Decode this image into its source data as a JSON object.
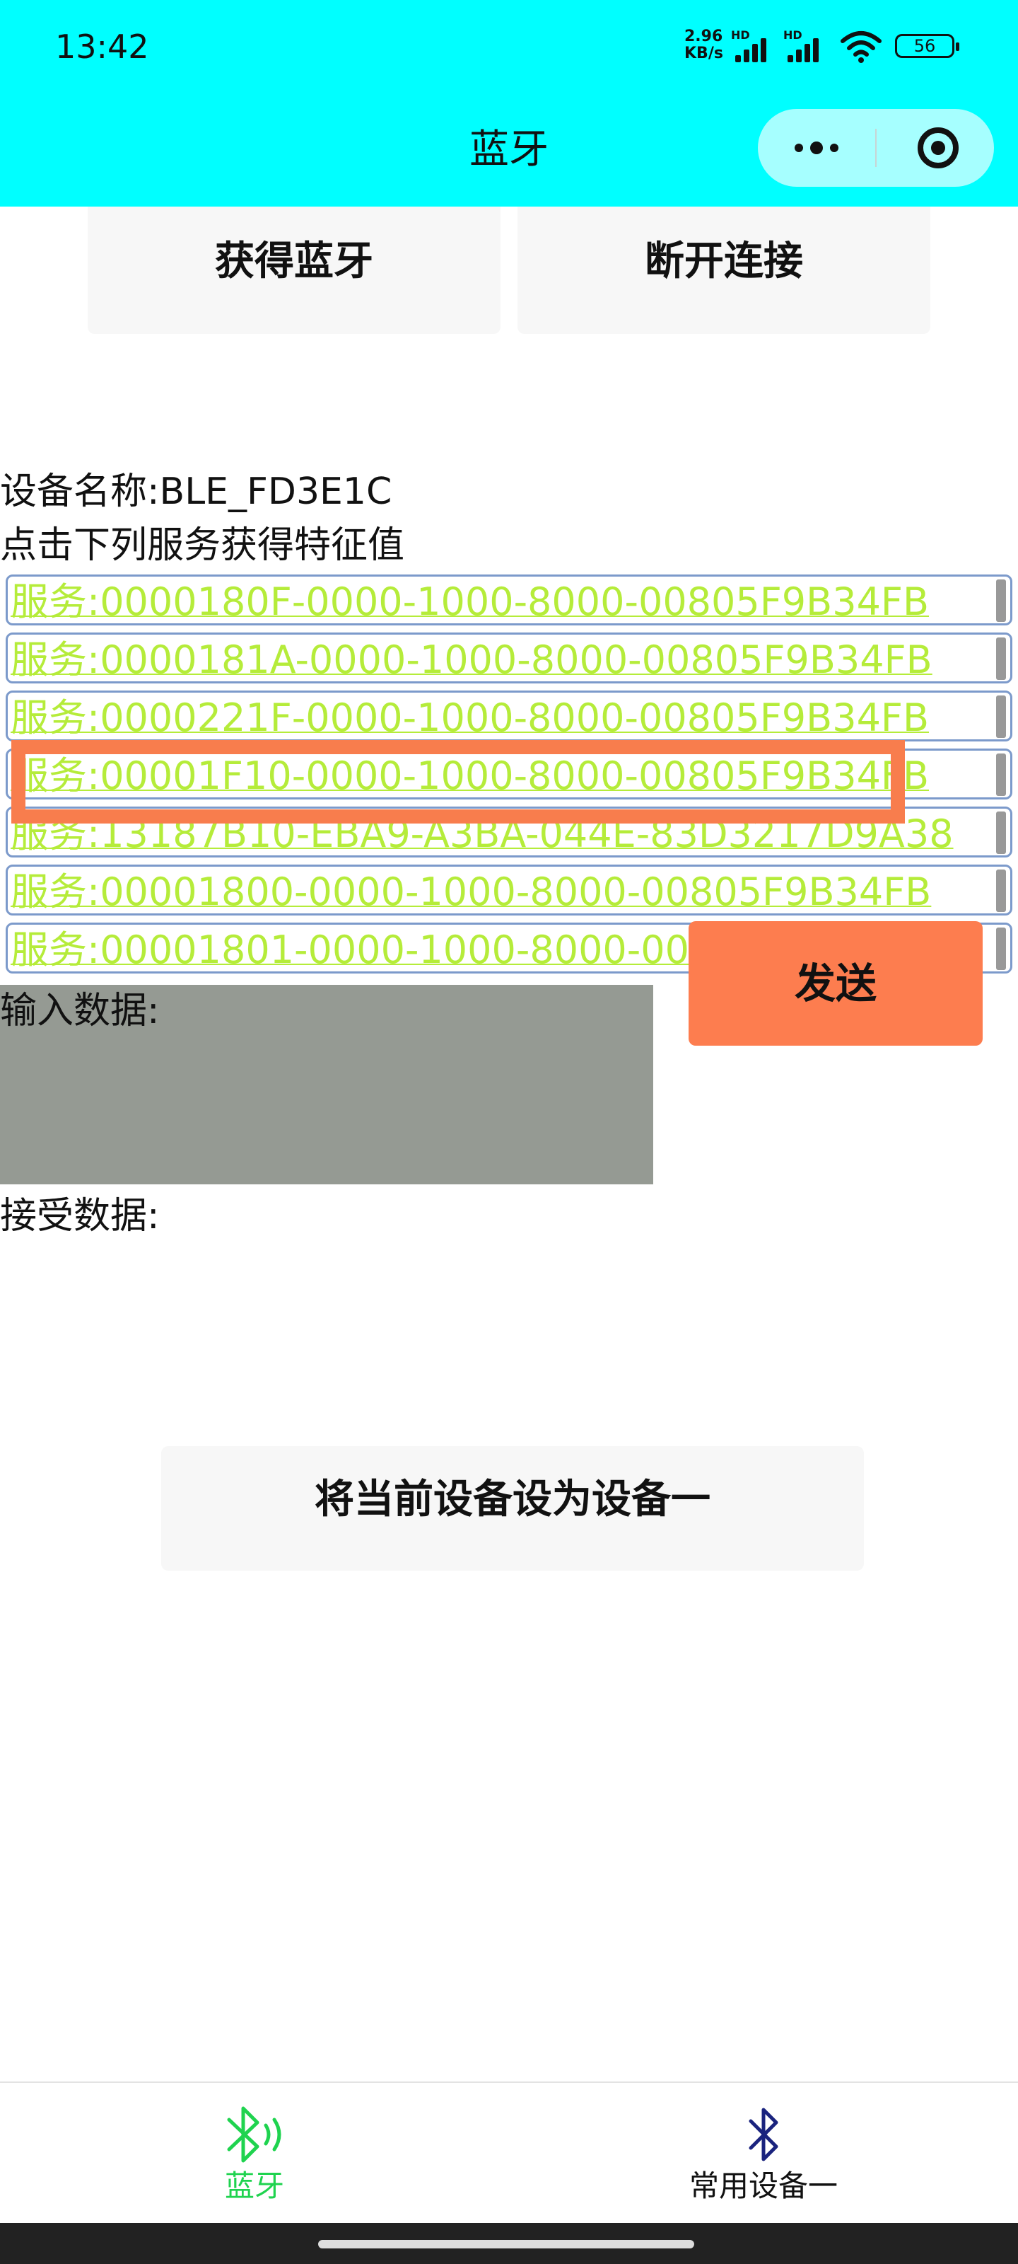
{
  "status": {
    "time": "13:42",
    "net_speed_value": "2.96",
    "net_speed_unit": "KB/s",
    "hd_label": "HD",
    "battery": "56"
  },
  "nav": {
    "title": "蓝牙"
  },
  "buttons": {
    "get_bluetooth": "获得蓝牙",
    "disconnect": "断开连接",
    "send": "发送",
    "set_device": "将当前设备设为设备一"
  },
  "device_name": "设备名称:BLE_FD3E1C",
  "hint": "点击下列服务获得特征值",
  "services": [
    "服务:0000180F-0000-1000-8000-00805F9B34FB",
    "服务:0000181A-0000-1000-8000-00805F9B34FB",
    "服务:0000221F-0000-1000-8000-00805F9B34FB",
    "服务:00001F10-0000-1000-8000-00805F9B34FB",
    "服务:13187B10-EBA9-A3BA-044E-83D3217D9A38",
    "服务:00001800-0000-1000-8000-00805F9B34FB",
    "服务:00001801-0000-1000-8000-00805F9B34FB"
  ],
  "input_label": "输入数据:",
  "receive_label": "接受数据:",
  "tabs": [
    {
      "label": "蓝牙",
      "icon": "bluetooth-active-icon",
      "color": "#1fd34f"
    },
    {
      "label": "常用设备一",
      "icon": "bluetooth-icon",
      "color": "#1a237e"
    }
  ],
  "colors": {
    "header_bg": "#00ffff",
    "service_text": "#b5ec3a",
    "highlight": "#f87d4d",
    "send_button": "#fd7d4f",
    "input_bg": "#959a93"
  }
}
